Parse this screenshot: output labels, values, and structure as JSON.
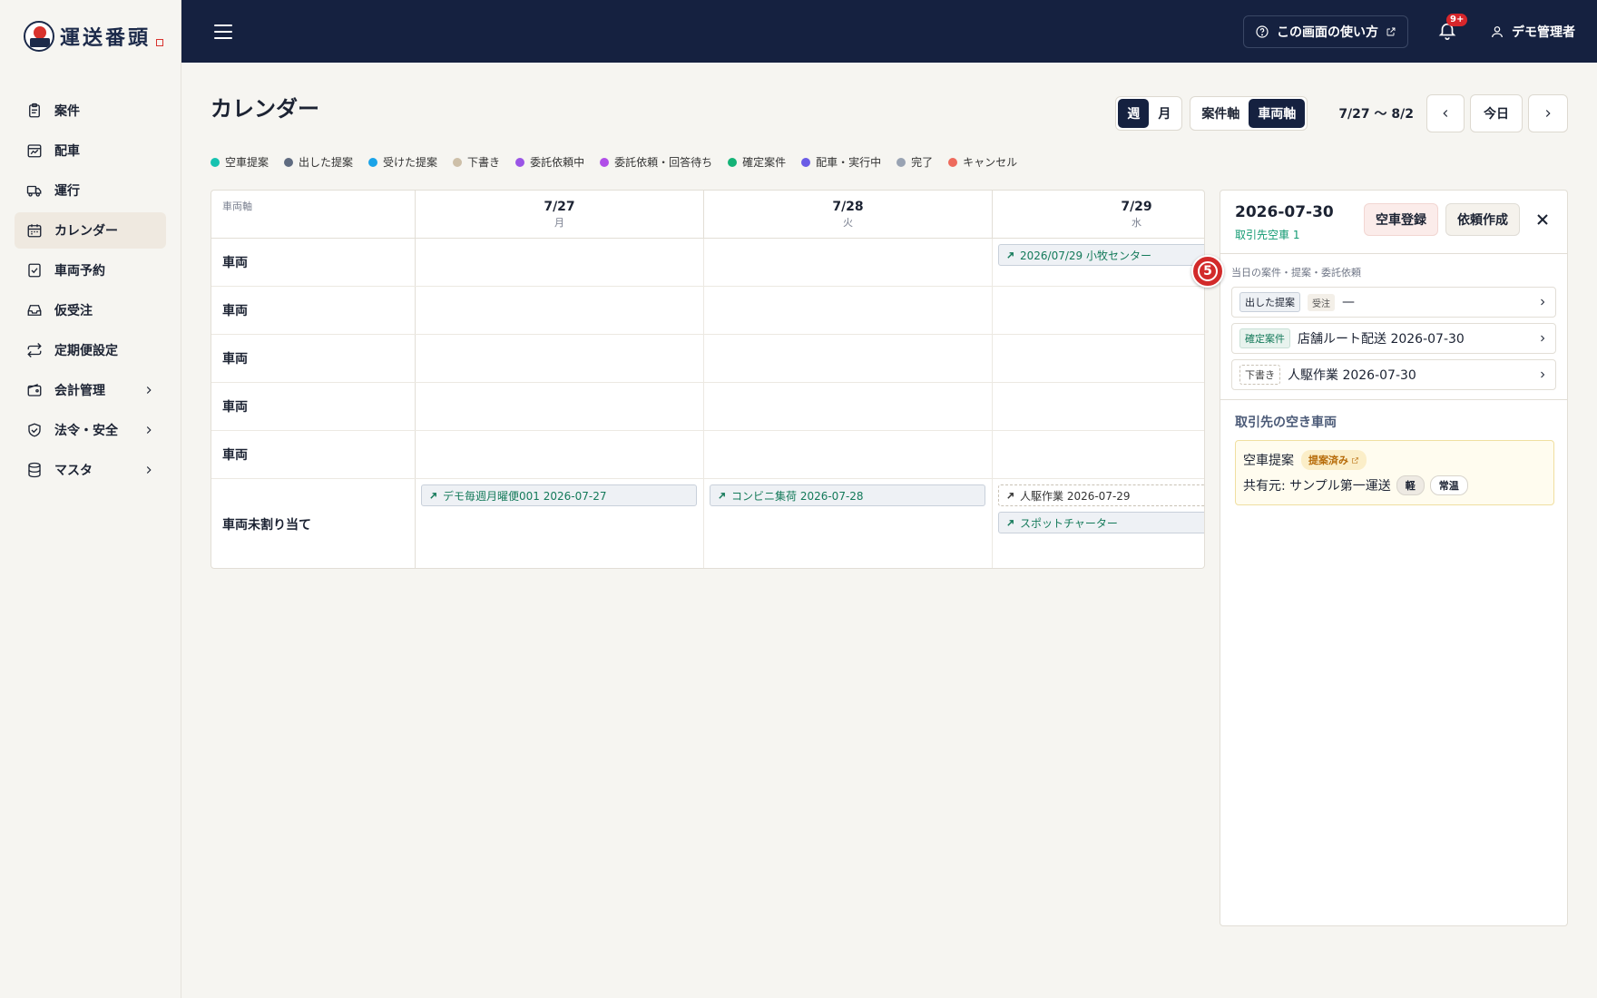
{
  "app": {
    "logo_text": "運送番頭"
  },
  "sidebar": {
    "items": [
      {
        "label": "案件",
        "icon": "clipboard-icon"
      },
      {
        "label": "配車",
        "icon": "calendar-chart-icon"
      },
      {
        "label": "運行",
        "icon": "truck-icon"
      },
      {
        "label": "カレンダー",
        "icon": "calendar-icon",
        "active": true
      },
      {
        "label": "車両予約",
        "icon": "calendar-check-icon"
      },
      {
        "label": "仮受注",
        "icon": "inbox-icon"
      },
      {
        "label": "定期便設定",
        "icon": "repeat-icon"
      },
      {
        "label": "会計管理",
        "icon": "wallet-icon",
        "has_submenu": true
      },
      {
        "label": "法令・安全",
        "icon": "shield-check-icon",
        "has_submenu": true
      },
      {
        "label": "マスタ",
        "icon": "database-icon",
        "has_submenu": true
      }
    ]
  },
  "topbar": {
    "help_label": "この画面の使い方",
    "notification_count": "9+",
    "user_name": "デモ管理者"
  },
  "page": {
    "title": "カレンダー",
    "view_week": "週",
    "view_month": "月",
    "axis_case": "案件軸",
    "axis_vehicle": "車両軸",
    "range": "7/27 〜 8/2",
    "today": "今日"
  },
  "legend": [
    {
      "label": "空車提案",
      "color": "#16c2b0"
    },
    {
      "label": "出した提案",
      "color": "#5f6b80"
    },
    {
      "label": "受けた提案",
      "color": "#1aa3e8"
    },
    {
      "label": "下書き",
      "color": "#cdbfa8"
    },
    {
      "label": "委託依頼中",
      "color": "#9a55e6"
    },
    {
      "label": "委託依頼・回答待ち",
      "color": "#b04ee8"
    },
    {
      "label": "確定案件",
      "color": "#14b377"
    },
    {
      "label": "配車・実行中",
      "color": "#6a5ce6"
    },
    {
      "label": "完了",
      "color": "#99a3b3"
    },
    {
      "label": "キャンセル",
      "color": "#ee6a5c"
    }
  ],
  "grid": {
    "axis_label": "車両軸",
    "days": [
      {
        "date": "7/27",
        "weekday": "月"
      },
      {
        "date": "7/28",
        "weekday": "火"
      },
      {
        "date": "7/29",
        "weekday": "水"
      }
    ],
    "rows": [
      {
        "label": "車両"
      },
      {
        "label": "車両"
      },
      {
        "label": "車両"
      },
      {
        "label": "車両"
      },
      {
        "label": "車両"
      },
      {
        "label": "車両未割り当て"
      }
    ],
    "events": {
      "row0_day2": "2026/07/29 小牧センター",
      "unassigned_day0": "デモ毎週月曜便001 2026-07-27",
      "unassigned_day1": "コンビニ集荷 2026-07-28",
      "unassigned_day2_a": "人駆作業 2026-07-29",
      "unassigned_day2_b": "スポットチャーター"
    }
  },
  "panel": {
    "date": "2026-07-30",
    "sub": "取引先空車 1",
    "register_vacancy": "空車登録",
    "create_request": "依頼作成",
    "section_label": "当日の案件・提案・委託依頼",
    "items": [
      {
        "tag": "出した提案",
        "subtag": "受注",
        "text": "—"
      },
      {
        "tag": "確定案件",
        "text": "店舗ルート配送 2026-07-30"
      },
      {
        "tag": "下書き",
        "text": "人駆作業 2026-07-30"
      }
    ],
    "vacancy_title": "取引先の空き車両",
    "vacancy_card": {
      "type": "空車提案",
      "status": "提案済み",
      "shared_from": "共有元: サンプル第一運送",
      "chip1": "軽",
      "chip2": "常温"
    }
  },
  "step_marker": "5"
}
